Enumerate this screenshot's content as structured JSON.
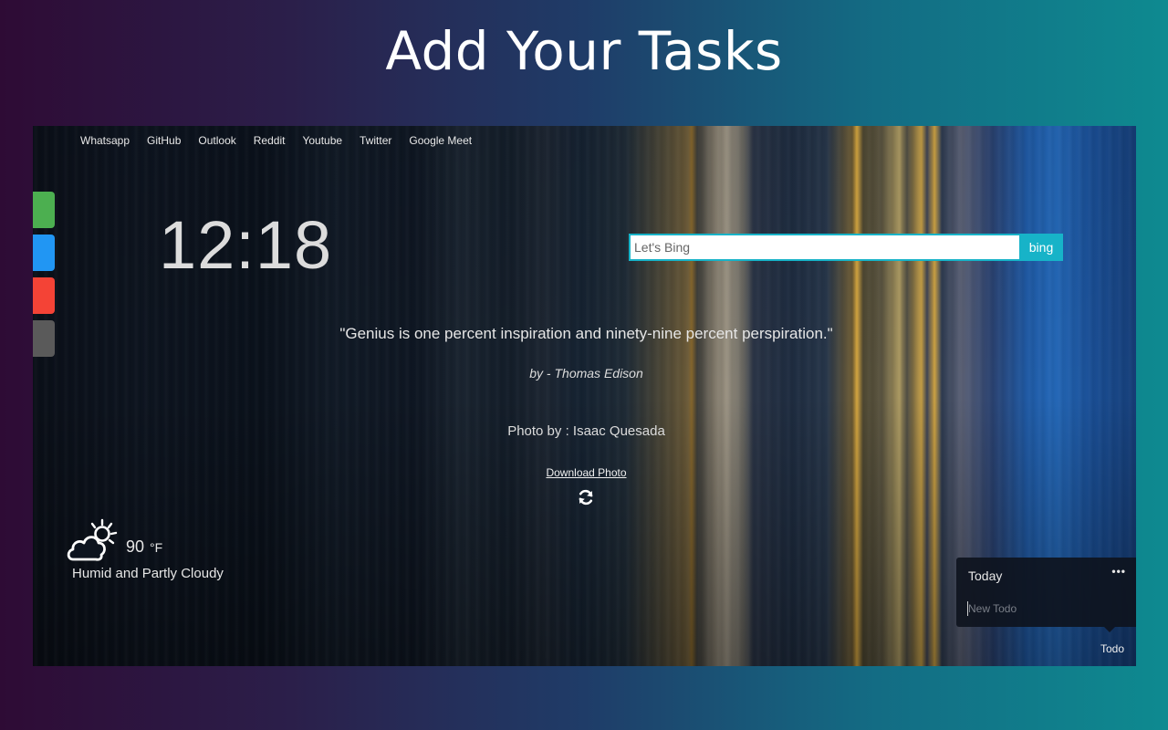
{
  "promo": {
    "heading": "Add Your Tasks"
  },
  "links": [
    {
      "label": "Whatsapp"
    },
    {
      "label": "GitHub"
    },
    {
      "label": "Outlook"
    },
    {
      "label": "Reddit"
    },
    {
      "label": "Youtube"
    },
    {
      "label": "Twitter"
    },
    {
      "label": "Google Meet"
    }
  ],
  "side_tabs": [
    {
      "color": "#4caf50"
    },
    {
      "color": "#2196f3"
    },
    {
      "color": "#f44336"
    },
    {
      "color": "#5a5a5a"
    }
  ],
  "clock": {
    "time": "12:18"
  },
  "search": {
    "placeholder": "Let's Bing",
    "button_label": "bing",
    "accent": "#17b3c8"
  },
  "quote": {
    "text": "\"Genius is one percent inspiration and ninety-nine percent perspiration.\"",
    "author": "by - Thomas Edison"
  },
  "photo": {
    "credit": "Photo by : Isaac Quesada",
    "download_label": "Download Photo",
    "refresh_icon": "refresh-icon"
  },
  "weather": {
    "icon": "partly-cloudy-day-icon",
    "temperature": "90",
    "unit": "°F",
    "condition": "Humid and Partly Cloudy"
  },
  "todo": {
    "title": "Today",
    "more_label": "•••",
    "input_placeholder": "New Todo",
    "toggle_label": "Todo"
  }
}
